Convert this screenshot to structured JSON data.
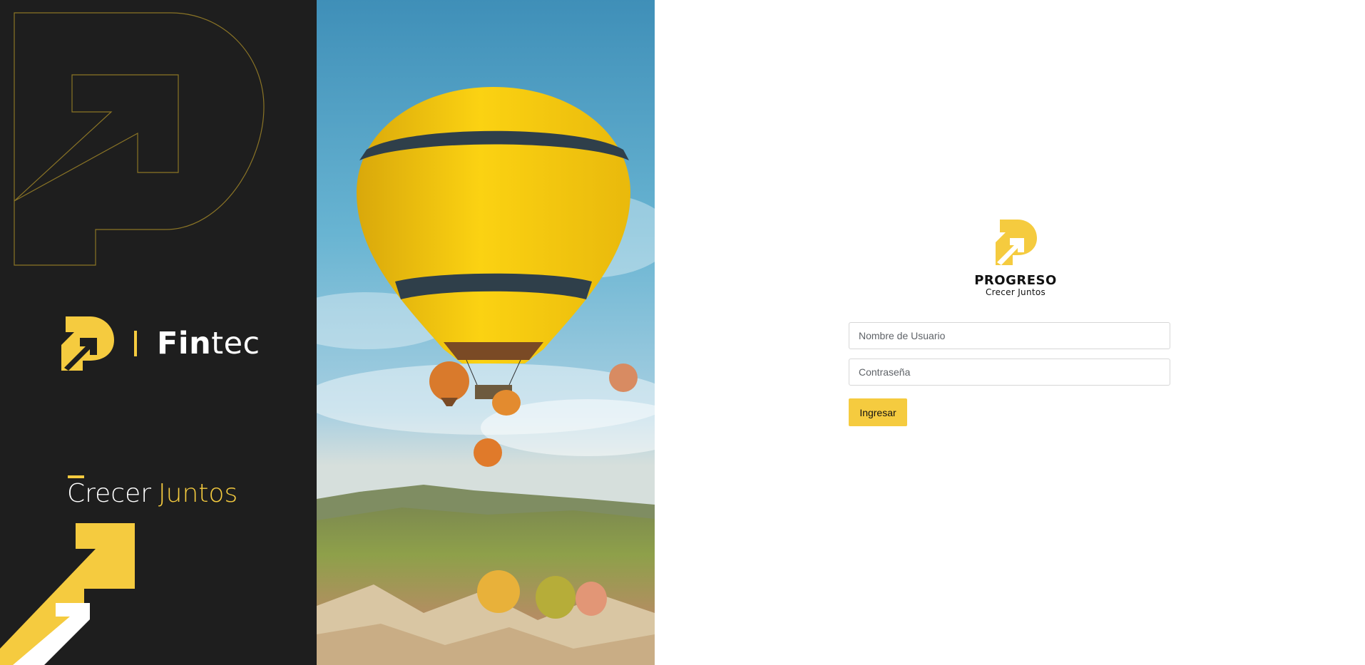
{
  "colors": {
    "accent": "#f5cb3f",
    "dark_panel": "#1e1e1e",
    "outline_stroke": "#8a7426",
    "text_dark": "#111111",
    "input_border": "#d6d6d6"
  },
  "left_panel": {
    "brand_word": {
      "bold": "Fin",
      "light": "tec"
    },
    "tagline": {
      "first": "Crecer",
      "second": "Juntos"
    },
    "icons": [
      "progreso-outline-logo-icon",
      "progreso-logo-icon",
      "arrows-icon"
    ]
  },
  "photo_panel": {
    "image": "hot-air-balloons-photo"
  },
  "login": {
    "logo": {
      "name": "PROGRESO",
      "subtitle": "Crecer Juntos"
    },
    "username": {
      "placeholder": "Nombre de Usuario",
      "value": ""
    },
    "password": {
      "placeholder": "Contraseña",
      "value": ""
    },
    "submit_label": "Ingresar"
  }
}
